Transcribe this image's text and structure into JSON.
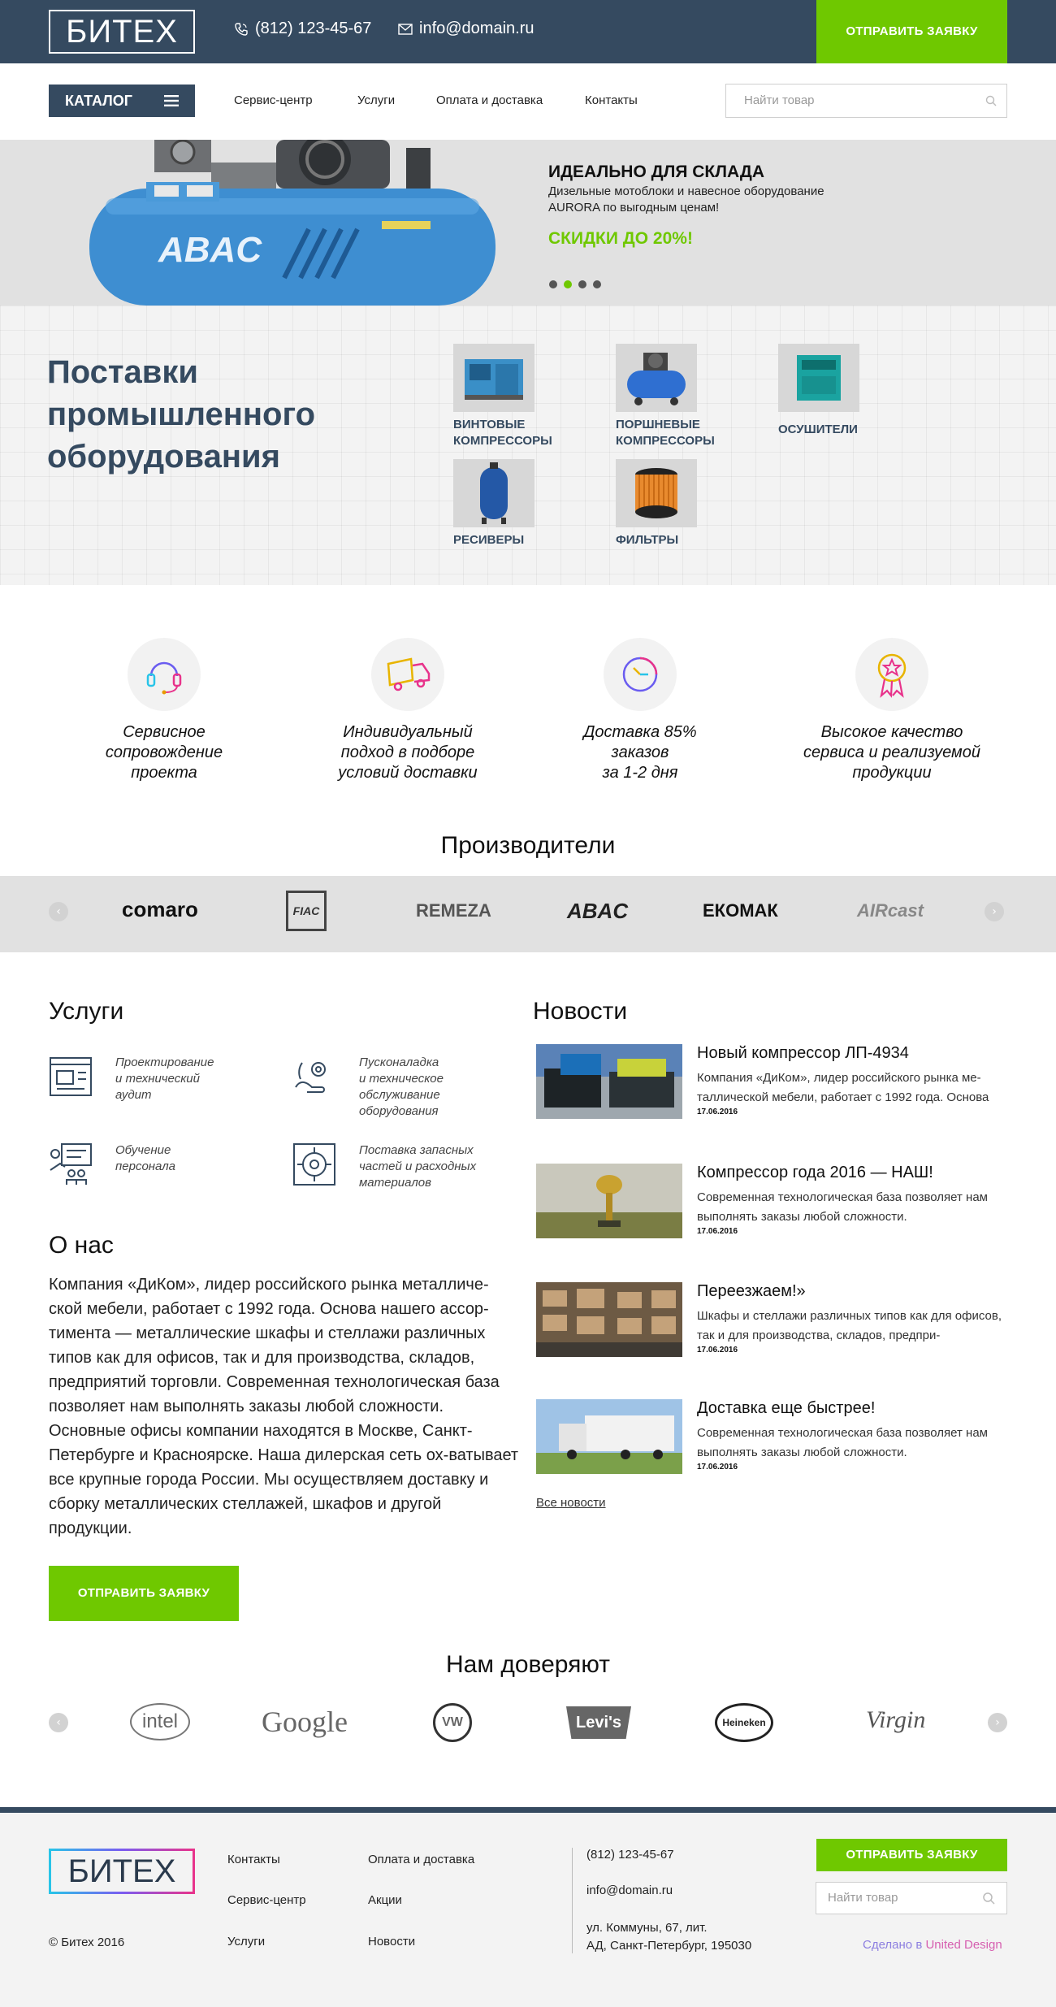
{
  "header": {
    "logo": "БИТЕХ",
    "phone": "(812) 123-45-67",
    "email": "info@domain.ru",
    "cta": "ОТПРАВИТЬ ЗАЯВКУ"
  },
  "nav": {
    "catalog": "КАТАЛОГ",
    "links": [
      "Сервис-центр",
      "Услуги",
      "Оплата и доставка",
      "Контакты"
    ],
    "search_placeholder": "Найти товар"
  },
  "hero": {
    "title": "ИДЕАЛЬНО ДЛЯ СКЛАДА",
    "text": "Дизельные мотоблоки и навесное оборудование AURORA по выгодным ценам!",
    "sale": "СКИДКИ ДО 20%!",
    "compressor_brand": "ABAC",
    "active_slide": 2,
    "slides": 4
  },
  "supplies": {
    "title": "Поставки промышленного оборудования",
    "categories": [
      {
        "label": "ВИНТОВЫЕ КОМПРЕССОРЫ",
        "icon": "screw-compressor-icon"
      },
      {
        "label": "ПОРШНЕВЫЕ КОМПРЕССОРЫ",
        "icon": "piston-compressor-icon"
      },
      {
        "label": "ОСУШИТЕЛИ",
        "icon": "dryer-icon"
      },
      {
        "label": "РЕСИВЕРЫ",
        "icon": "receiver-icon"
      },
      {
        "label": "ФИЛЬТРЫ",
        "icon": "filter-icon"
      }
    ]
  },
  "features": [
    {
      "text": "Сервисное\nсопровождение\nпроекта",
      "icon": "headset-icon"
    },
    {
      "text": "Индивидуальный\nподход в подборе\nусловий доставки",
      "icon": "truck-icon"
    },
    {
      "text": "Доставка 85%\nзаказов\nза 1-2 дня",
      "icon": "clock-icon"
    },
    {
      "text": "Высокое качество\nсервиса и реализуемой\nпродукции",
      "icon": "award-icon"
    }
  ],
  "manufacturers": {
    "title": "Производители",
    "brands": [
      "comaro",
      "FIAC",
      "REMEZA",
      "ABAC",
      "ЕКОМАК",
      "AIRcast"
    ]
  },
  "services": {
    "title": "Услуги",
    "items": [
      {
        "text": "Проектирование\nи технический\nаудит",
        "icon": "blueprint-icon"
      },
      {
        "text": "Пусконаладка\nи техническое\nобслуживание\nоборудования",
        "icon": "gear-hand-icon"
      },
      {
        "text": "Обучение\nперсонала",
        "icon": "training-icon"
      },
      {
        "text": "Поставка запасных\nчастей и расходных\nматериалов",
        "icon": "parts-icon"
      }
    ]
  },
  "about": {
    "title": "О нас",
    "text": "Компания «ДиКом», лидер российского рынка металличе-ской мебели, работает с 1992 года. Основа нашего ассор-тимента — металлические шкафы и стеллажи различных типов как для офисов, так и для производства, складов, предприятий торговли. Современная технологическая база позволяет нам выполнять заказы любой сложности. Основные офисы компании находятся в Москве, Санкт-Петербурге и Красноярске. Наша дилерская сеть ох-ватывает все крупные города России. Мы осуществляем доставку и сборку металлических стеллажей, шкафов и другой продукции.",
    "cta": "ОТПРАВИТЬ ЗАЯВКУ"
  },
  "news": {
    "title": "Новости",
    "items": [
      {
        "title": "Новый компрессор ЛП-4934",
        "text": "Компания «ДиКом», лидер российского рынка ме-таллической мебели, работает с 1992 года. Основа",
        "date": "17.06.2016"
      },
      {
        "title": "Компрессор года 2016 — НАШ!",
        "text": "Современная технологическая база позволяет нам выполнять заказы любой сложности.",
        "date": "17.06.2016"
      },
      {
        "title": "Переезжаем!»",
        "text": "Шкафы и стеллажи различных типов как для офисов, так и для производства, складов, предпри-",
        "date": "17.06.2016"
      },
      {
        "title": "Доставка еще быстрее!",
        "text": "Современная технологическая база позволяет нам выполнять заказы любой сложности.",
        "date": "17.06.2016"
      }
    ],
    "all": "Все новости"
  },
  "trust": {
    "title": "Нам доверяют",
    "logos": [
      "intel",
      "Google",
      "VW",
      "Levi's",
      "Heineken",
      "Virgin"
    ]
  },
  "footer": {
    "logo": "БИТЕХ",
    "copyright": "© Битех 2016",
    "col1": [
      "Контакты",
      "Сервис-центр",
      "Услуги"
    ],
    "col2": [
      "Оплата и доставка",
      "Акции",
      "Новости"
    ],
    "phone": "(812) 123-45-67",
    "email": "info@domain.ru",
    "address": "ул. Коммуны, 67, лит.\nАД, Санкт-Петербург, 195030",
    "cta": "ОТПРАВИТЬ ЗАЯВКУ",
    "search_placeholder": "Найти товар",
    "made_by_prefix": "Сделано в ",
    "made_by": "United Design"
  },
  "colors": {
    "primary": "#354a60",
    "accent": "#6fc800",
    "hero_bg": "#e1e1e1",
    "compressor": "#3e8ed1"
  }
}
